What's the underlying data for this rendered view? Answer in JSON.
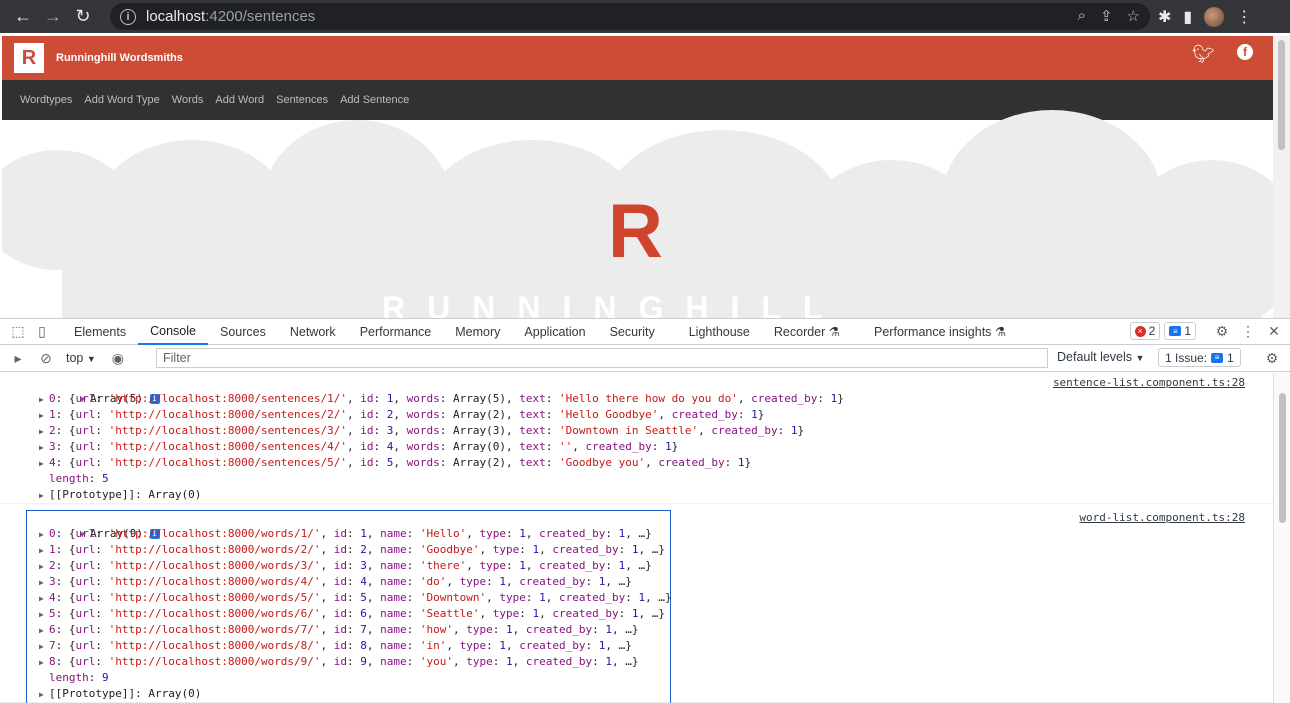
{
  "browser": {
    "url_host": "localhost",
    "url_path": ":4200/sentences"
  },
  "site": {
    "title": "Runninghill Wordsmiths",
    "logo_letter": "R",
    "nav": [
      "Wordtypes",
      "Add Word Type",
      "Words",
      "Add Word",
      "Sentences",
      "Add Sentence"
    ],
    "hero_letter": "R",
    "hero_text": "RUNNINGHILL"
  },
  "devtools": {
    "tabs": [
      "Elements",
      "Console",
      "Sources",
      "Network",
      "Performance",
      "Memory",
      "Application",
      "Security",
      "Lighthouse",
      "Recorder",
      "Performance insights"
    ],
    "active_tab": "Console",
    "error_count": "2",
    "message_count": "1",
    "context": "top",
    "filter_placeholder": "Filter",
    "levels": "Default levels",
    "issues_label": "1 Issue:",
    "issues_count": "1"
  },
  "console": {
    "sentences": {
      "header": "Array(5)",
      "source": "sentence-list.component.ts:28",
      "items": [
        {
          "idx": "0",
          "url": "'http://localhost:8000/sentences/1/'",
          "id": "1",
          "words": "Array(5)",
          "text": "'Hello there how do you do'",
          "created_by": "1"
        },
        {
          "idx": "1",
          "url": "'http://localhost:8000/sentences/2/'",
          "id": "2",
          "words": "Array(2)",
          "text": "'Hello Goodbye'",
          "created_by": "1"
        },
        {
          "idx": "2",
          "url": "'http://localhost:8000/sentences/3/'",
          "id": "3",
          "words": "Array(3)",
          "text": "'Downtown in Seattle'",
          "created_by": "1"
        },
        {
          "idx": "3",
          "url": "'http://localhost:8000/sentences/4/'",
          "id": "4",
          "words": "Array(0)",
          "text": "''",
          "created_by": "1"
        },
        {
          "idx": "4",
          "url": "'http://localhost:8000/sentences/5/'",
          "id": "5",
          "words": "Array(2)",
          "text": "'Goodbye you'",
          "created_by": "1"
        }
      ],
      "length": "5",
      "prototype": "Array(0)"
    },
    "words": {
      "header": "Array(9)",
      "source": "word-list.component.ts:28",
      "items": [
        {
          "idx": "0",
          "url": "'http://localhost:8000/words/1/'",
          "id": "1",
          "name": "'Hello'",
          "type": "1",
          "created_by": "1"
        },
        {
          "idx": "1",
          "url": "'http://localhost:8000/words/2/'",
          "id": "2",
          "name": "'Goodbye'",
          "type": "1",
          "created_by": "1"
        },
        {
          "idx": "2",
          "url": "'http://localhost:8000/words/3/'",
          "id": "3",
          "name": "'there'",
          "type": "1",
          "created_by": "1"
        },
        {
          "idx": "3",
          "url": "'http://localhost:8000/words/4/'",
          "id": "4",
          "name": "'do'",
          "type": "1",
          "created_by": "1"
        },
        {
          "idx": "4",
          "url": "'http://localhost:8000/words/5/'",
          "id": "5",
          "name": "'Downtown'",
          "type": "1",
          "created_by": "1"
        },
        {
          "idx": "5",
          "url": "'http://localhost:8000/words/6/'",
          "id": "6",
          "name": "'Seattle'",
          "type": "1",
          "created_by": "1"
        },
        {
          "idx": "6",
          "url": "'http://localhost:8000/words/7/'",
          "id": "7",
          "name": "'how'",
          "type": "1",
          "created_by": "1"
        },
        {
          "idx": "7",
          "url": "'http://localhost:8000/words/8/'",
          "id": "8",
          "name": "'in'",
          "type": "1",
          "created_by": "1"
        },
        {
          "idx": "8",
          "url": "'http://localhost:8000/words/9/'",
          "id": "9",
          "name": "'you'",
          "type": "1",
          "created_by": "1"
        }
      ],
      "length": "9",
      "prototype": "Array(0)"
    }
  },
  "colors": {
    "brand": "#cd4c36",
    "nav_bg": "#313131",
    "devtools_accent": "#1a73e8"
  }
}
